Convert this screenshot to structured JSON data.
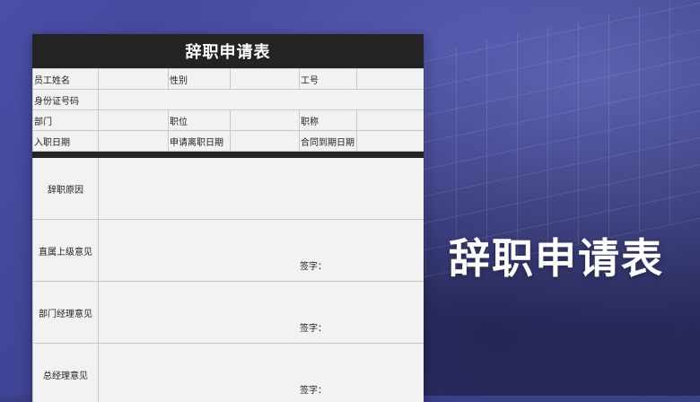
{
  "form": {
    "title": "辞职申请表",
    "rows": {
      "name_label": "员工姓名",
      "gender_label": "性别",
      "id_no_label": "工号",
      "idcard_label": "身份证号码",
      "dept_label": "部门",
      "position_label": "职位",
      "rank_label": "职称",
      "join_label": "入职日期",
      "apply_leave_label": "申请离职日期",
      "contract_end_label": "合同到期日期"
    },
    "sections": {
      "reason_label": "辞职原因",
      "supervisor_label": "直属上级意见",
      "dept_manager_label": "部门经理意见",
      "gm_label": "总经理意见",
      "sign_label": "签字："
    }
  },
  "headline": "辞职申请表"
}
